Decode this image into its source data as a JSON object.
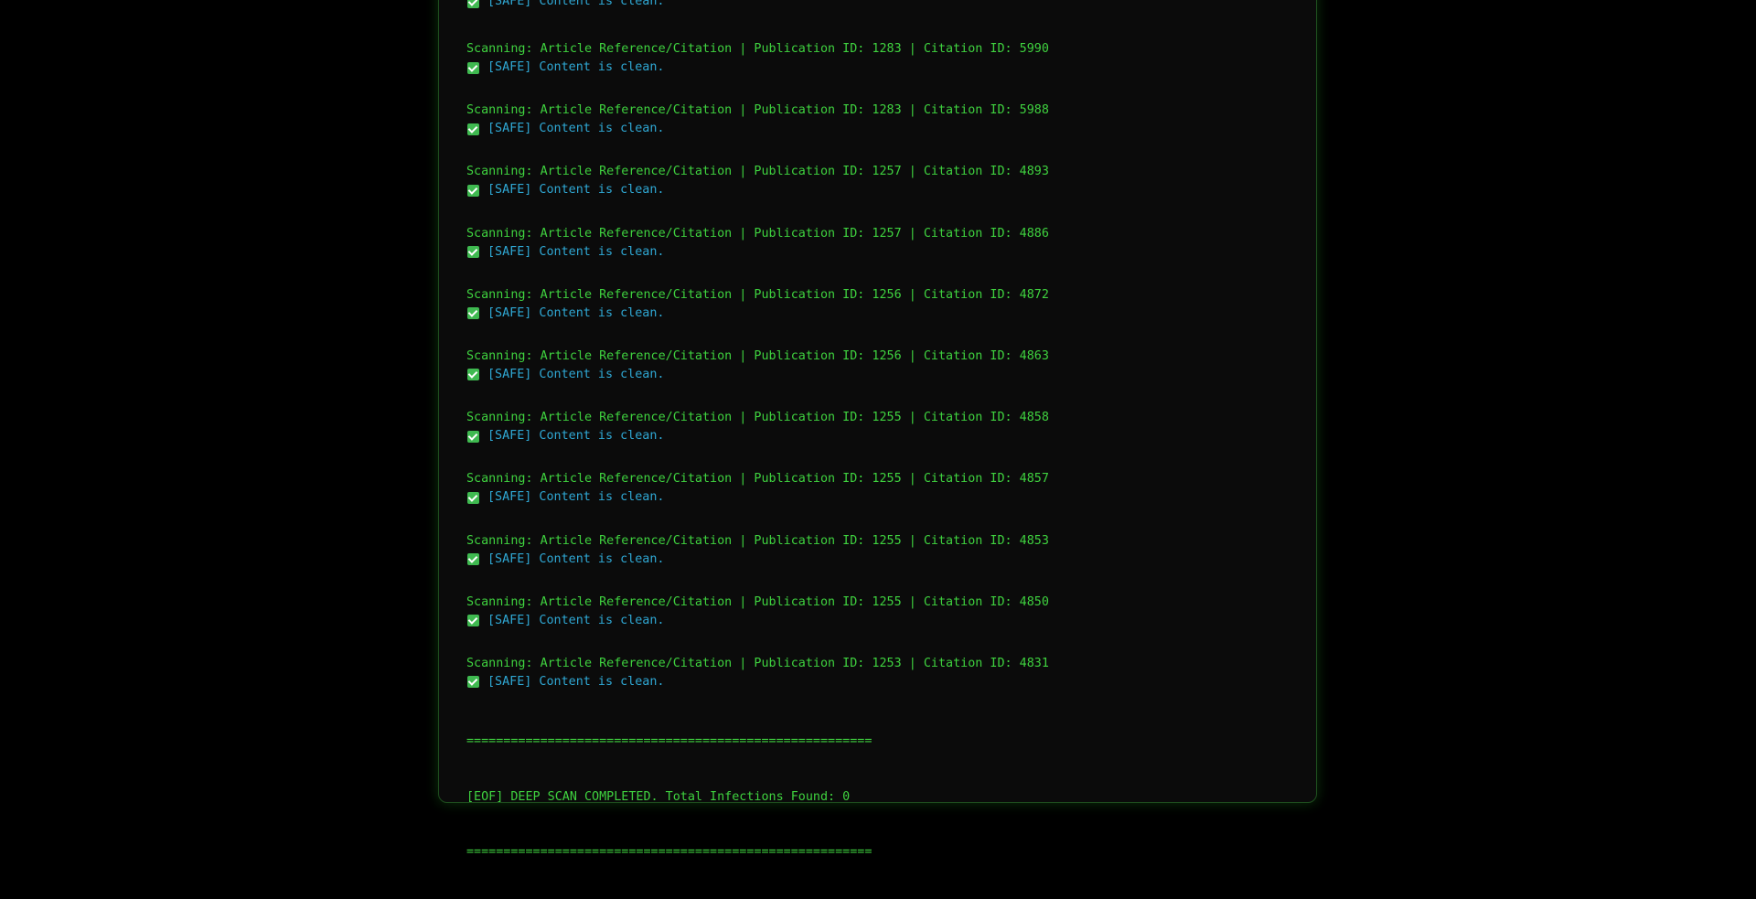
{
  "log": {
    "first_safe": "[SAFE] Content is clean.",
    "entries": [
      {
        "scan": "Scanning: Article Reference/Citation | Publication ID: 1283 | Citation ID: 5990",
        "safe": "[SAFE] Content is clean."
      },
      {
        "scan": "Scanning: Article Reference/Citation | Publication ID: 1283 | Citation ID: 5988",
        "safe": "[SAFE] Content is clean."
      },
      {
        "scan": "Scanning: Article Reference/Citation | Publication ID: 1257 | Citation ID: 4893",
        "safe": "[SAFE] Content is clean."
      },
      {
        "scan": "Scanning: Article Reference/Citation | Publication ID: 1257 | Citation ID: 4886",
        "safe": "[SAFE] Content is clean."
      },
      {
        "scan": "Scanning: Article Reference/Citation | Publication ID: 1256 | Citation ID: 4872",
        "safe": "[SAFE] Content is clean."
      },
      {
        "scan": "Scanning: Article Reference/Citation | Publication ID: 1256 | Citation ID: 4863",
        "safe": "[SAFE] Content is clean."
      },
      {
        "scan": "Scanning: Article Reference/Citation | Publication ID: 1255 | Citation ID: 4858",
        "safe": "[SAFE] Content is clean."
      },
      {
        "scan": "Scanning: Article Reference/Citation | Publication ID: 1255 | Citation ID: 4857",
        "safe": "[SAFE] Content is clean."
      },
      {
        "scan": "Scanning: Article Reference/Citation | Publication ID: 1255 | Citation ID: 4853",
        "safe": "[SAFE] Content is clean."
      },
      {
        "scan": "Scanning: Article Reference/Citation | Publication ID: 1255 | Citation ID: 4850",
        "safe": "[SAFE] Content is clean."
      },
      {
        "scan": "Scanning: Article Reference/Citation | Publication ID: 1253 | Citation ID: 4831",
        "safe": "[SAFE] Content is clean."
      }
    ]
  },
  "footer": {
    "separator": "=======================================================",
    "summary": "[EOF] DEEP SCAN COMPLETED. Total Infections Found: 0"
  },
  "icons": {
    "safe": "check-box-icon"
  },
  "colors": {
    "scan_text": "#3fd23f",
    "safe_text": "#2fa8d4",
    "check_icon": "#3fb950",
    "background": "#000000",
    "panel": "#0b0b0b"
  }
}
